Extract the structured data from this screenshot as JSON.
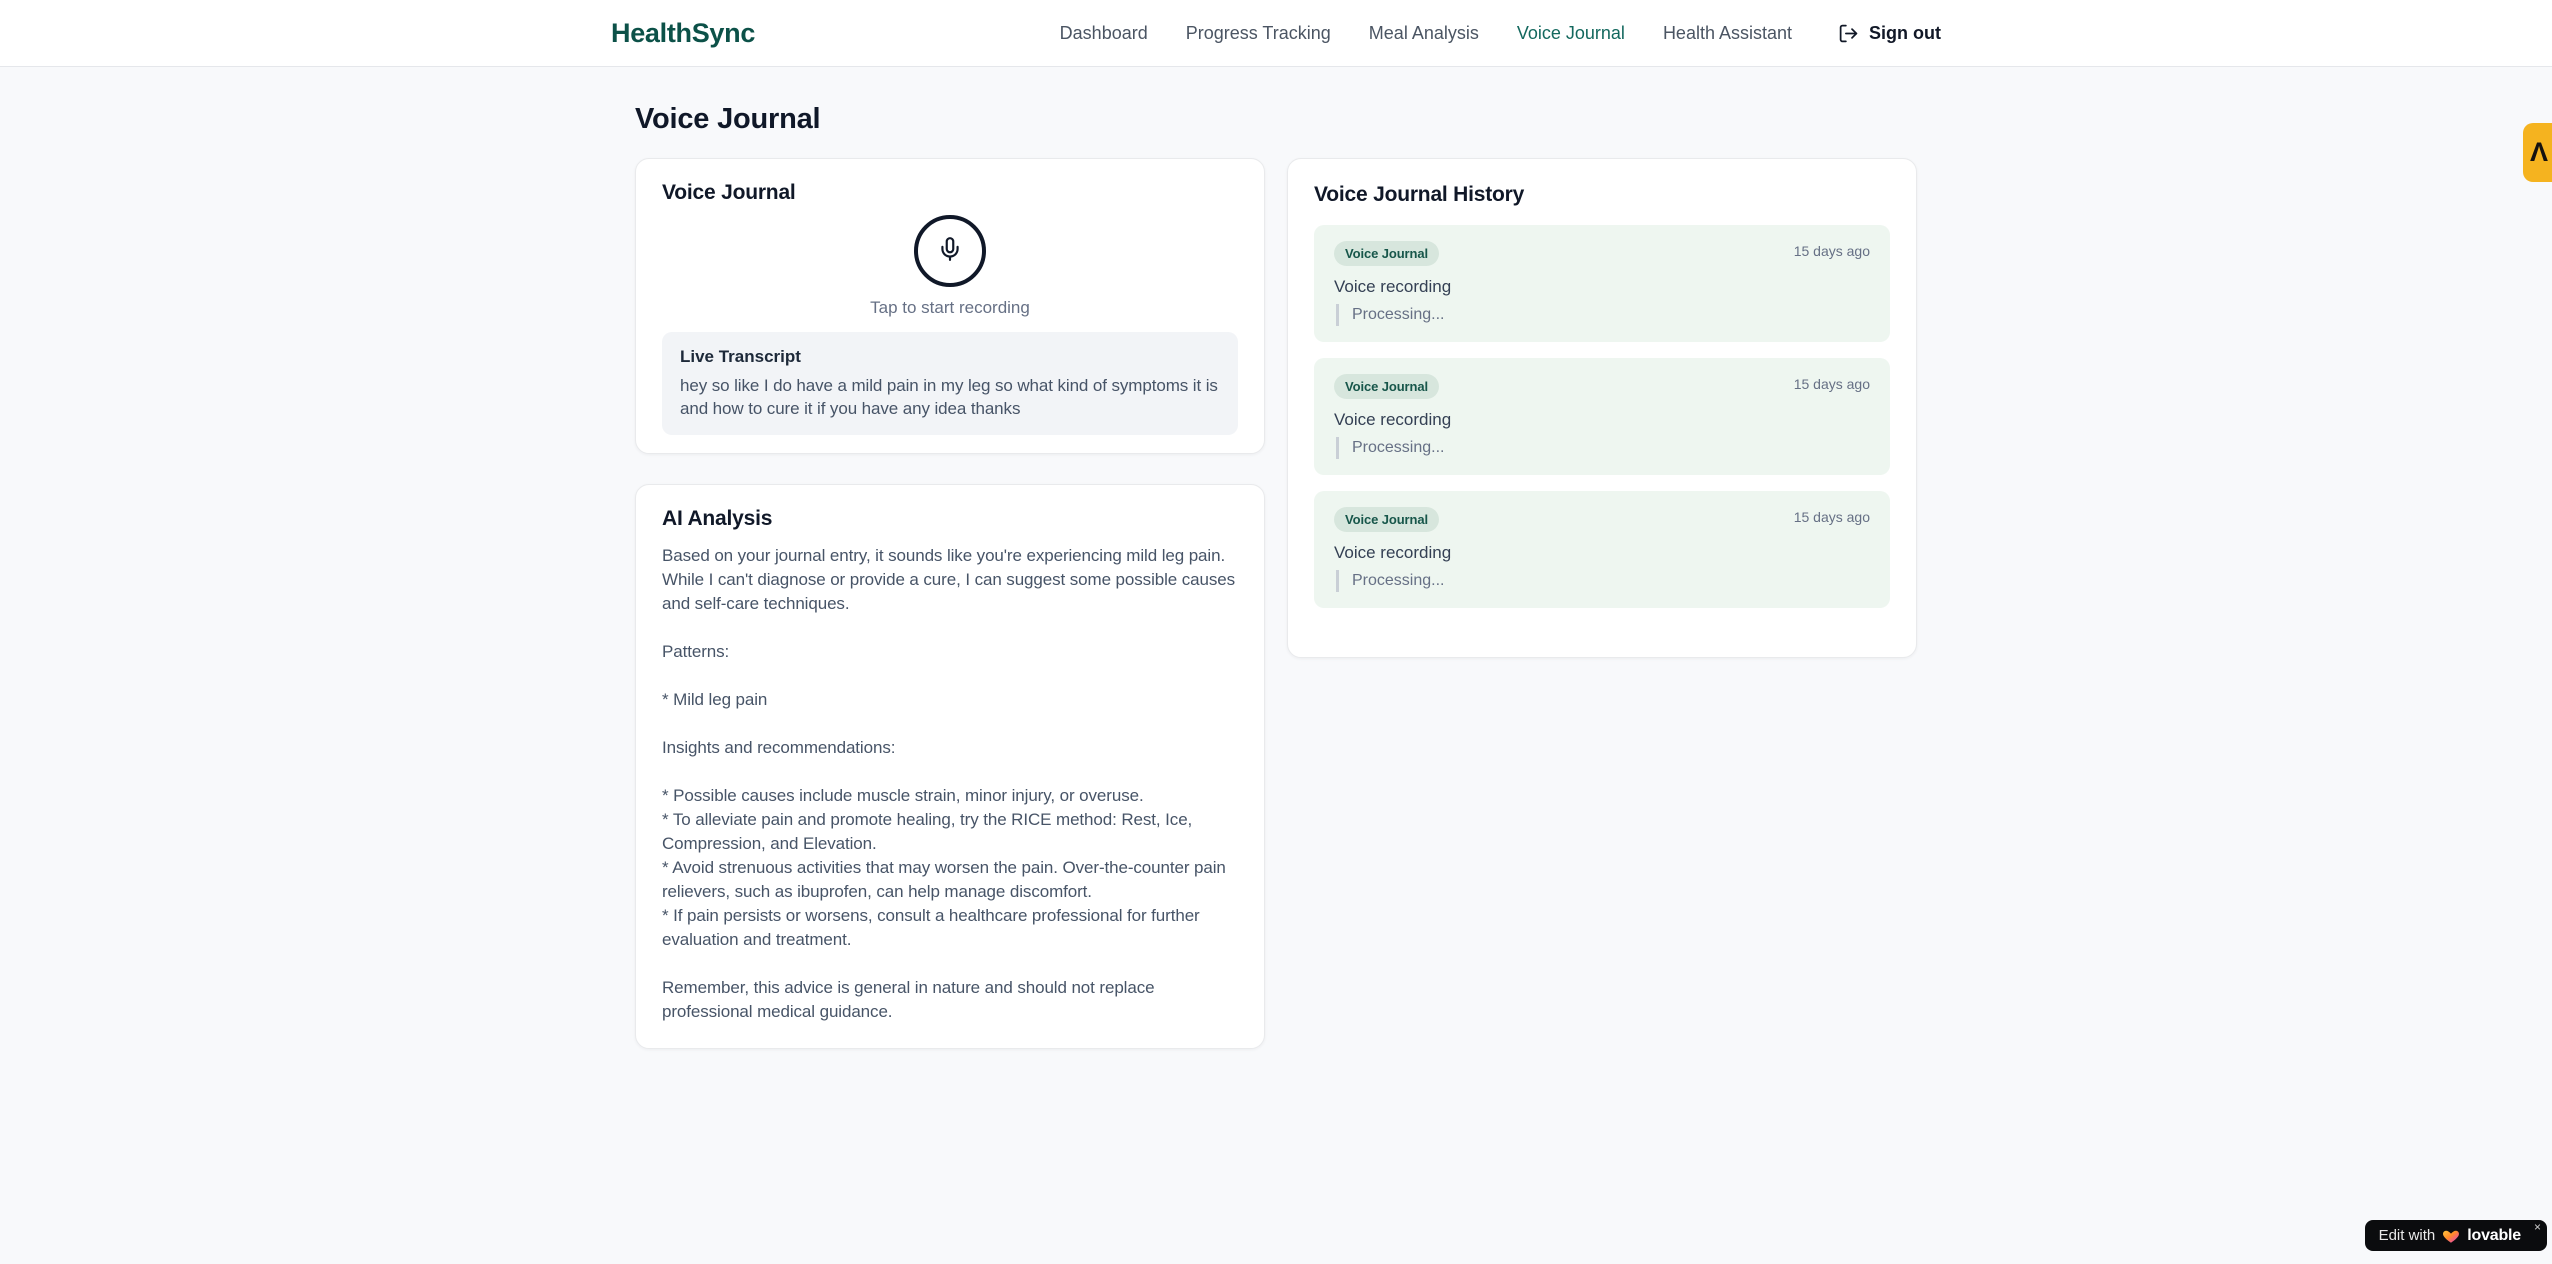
{
  "brand": {
    "name": "HealthSync"
  },
  "nav": {
    "items": [
      {
        "label": "Dashboard",
        "active": false
      },
      {
        "label": "Progress Tracking",
        "active": false
      },
      {
        "label": "Meal Analysis",
        "active": false
      },
      {
        "label": "Voice Journal",
        "active": true
      },
      {
        "label": "Health Assistant",
        "active": false
      }
    ],
    "signout_label": "Sign out"
  },
  "page": {
    "title": "Voice Journal"
  },
  "recorder": {
    "card_title": "Voice Journal",
    "tap_hint": "Tap to start recording",
    "transcript_title": "Live Transcript",
    "transcript_text": "hey so like I do have a mild pain in my leg so what kind of symptoms it is and how to cure it if you have any idea thanks"
  },
  "analysis": {
    "card_title": "AI Analysis",
    "body": "Based on your journal entry, it sounds like you're experiencing mild leg pain. While I can't diagnose or provide a cure, I can suggest some possible causes and self-care techniques.\n\nPatterns:\n\n* Mild leg pain\n\nInsights and recommendations:\n\n* Possible causes include muscle strain, minor injury, or overuse.\n* To alleviate pain and promote healing, try the RICE method: Rest, Ice, Compression, and Elevation.\n* Avoid strenuous activities that may worsen the pain. Over-the-counter pain relievers, such as ibuprofen, can help manage discomfort.\n* If pain persists or worsens, consult a healthcare professional for further evaluation and treatment.\n\nRemember, this advice is general in nature and should not replace professional medical guidance."
  },
  "history": {
    "title": "Voice Journal History",
    "entries": [
      {
        "badge": "Voice Journal",
        "time": "15 days ago",
        "label": "Voice recording",
        "status": "Processing..."
      },
      {
        "badge": "Voice Journal",
        "time": "15 days ago",
        "label": "Voice recording",
        "status": "Processing..."
      },
      {
        "badge": "Voice Journal",
        "time": "15 days ago",
        "label": "Voice recording",
        "status": "Processing..."
      }
    ]
  },
  "floating": {
    "edit_prefix": "Edit with",
    "edit_brand": "lovable",
    "close_glyph": "×",
    "side_badge_glyph": "Λ"
  },
  "colors": {
    "brand_teal": "#0c5148",
    "active_nav": "#13685e",
    "entry_green_bg": "#eef6f0",
    "badge_bg": "#d7e6dd",
    "badge_text": "#17564a",
    "amber_badge": "#f5b31f",
    "page_bg": "#f8f9fb"
  }
}
